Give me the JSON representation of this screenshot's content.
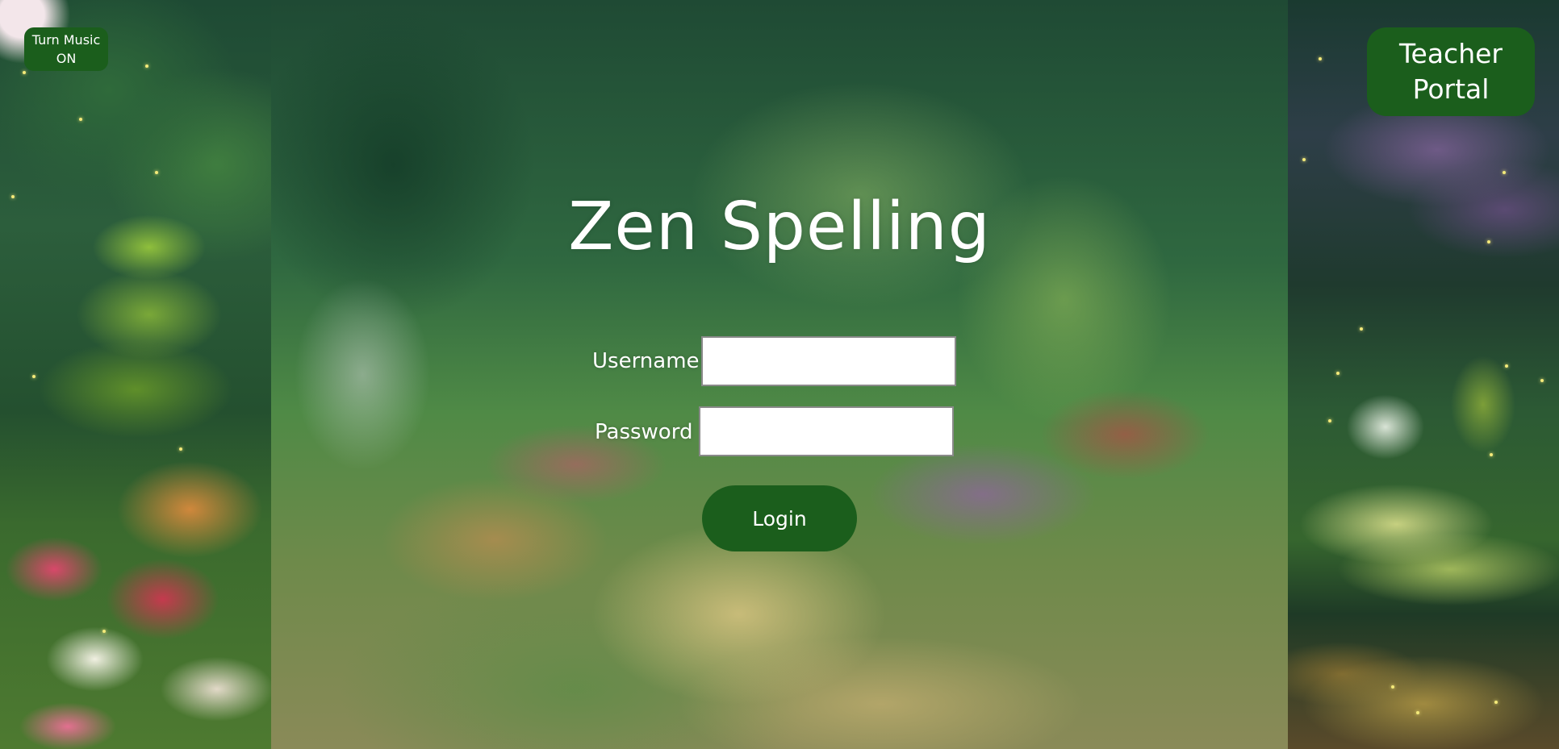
{
  "app": {
    "title": "Zen Spelling"
  },
  "music_toggle": {
    "line1": "Turn Music",
    "line2": "ON"
  },
  "teacher_portal": {
    "line1": "Teacher",
    "line2": "Portal"
  },
  "login_form": {
    "username_label": "Username",
    "username_value": "",
    "password_label": "Password",
    "password_value": "",
    "submit_label": "Login"
  },
  "colors": {
    "button_green": "#1b5e1c",
    "text": "#ffffff",
    "firefly": "#f4ea7a"
  }
}
